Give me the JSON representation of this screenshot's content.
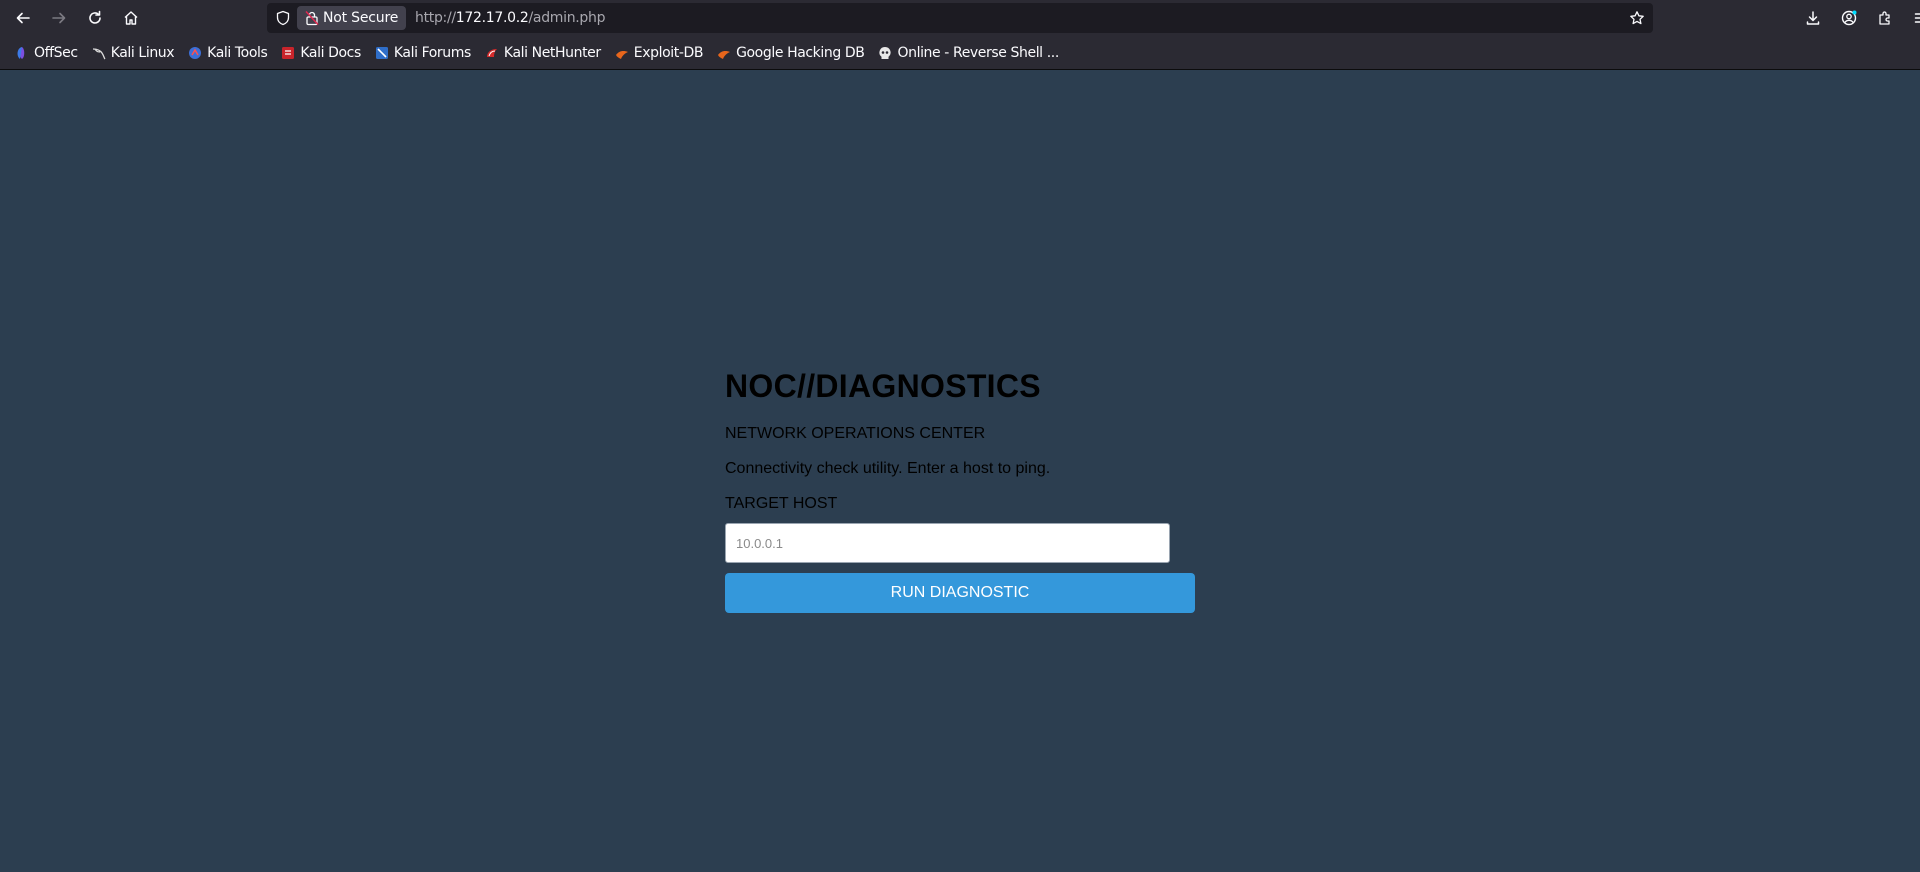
{
  "browser": {
    "security_label": "Not Secure",
    "url": {
      "protocol": "http://",
      "host": "172.17.0.2",
      "path": "/admin.php"
    },
    "bookmarks": [
      {
        "label": "OffSec",
        "icon": "offsec-icon"
      },
      {
        "label": "Kali Linux",
        "icon": "kali-dragon-icon"
      },
      {
        "label": "Kali Tools",
        "icon": "kali-tools-icon"
      },
      {
        "label": "Kali Docs",
        "icon": "kali-docs-icon"
      },
      {
        "label": "Kali Forums",
        "icon": "kali-forums-icon"
      },
      {
        "label": "Kali NetHunter",
        "icon": "nethunter-icon"
      },
      {
        "label": "Exploit-DB",
        "icon": "exploit-db-icon"
      },
      {
        "label": "Google Hacking DB",
        "icon": "ghdb-icon"
      },
      {
        "label": "Online - Reverse Shell ...",
        "icon": "skull-icon"
      }
    ]
  },
  "page": {
    "title": "NOC//DIAGNOSTICS",
    "subtitle": "NETWORK OPERATIONS CENTER",
    "description": "Connectivity check utility. Enter a host to ping.",
    "target_label": "TARGET HOST",
    "target_placeholder": "10.0.0.1",
    "run_button_label": "RUN DIAGNOSTIC"
  },
  "colors": {
    "page_background": "#2c3e50",
    "button_background": "#3498db",
    "chrome_background": "#2b2a33"
  }
}
